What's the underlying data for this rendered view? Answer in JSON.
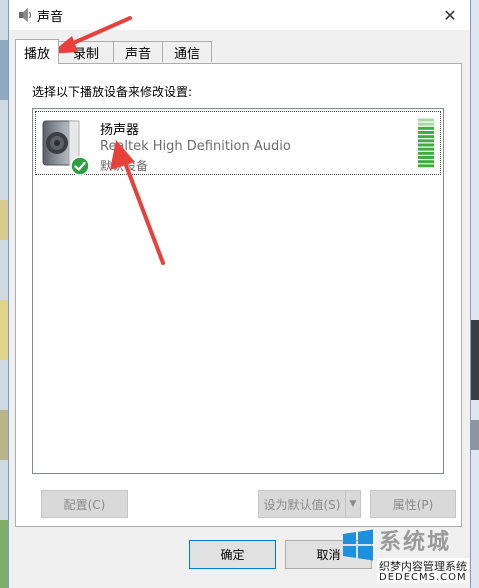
{
  "window": {
    "title": "声音",
    "close_glyph": "✕"
  },
  "tabs": [
    {
      "label": "播放",
      "active": true
    },
    {
      "label": "录制",
      "active": false
    },
    {
      "label": "声音",
      "active": false
    },
    {
      "label": "通信",
      "active": false
    }
  ],
  "playback": {
    "instruction": "选择以下播放设备来修改设置:",
    "devices": [
      {
        "name": "扬声器",
        "description": "Realtek High Definition Audio",
        "status": "默认设备",
        "icon": "speaker-icon",
        "badge_icon": "check-badge-icon",
        "level_segments_total": 12,
        "level_segments_lit": 10
      }
    ],
    "buttons": {
      "configure": "配置(C)",
      "set_default": "设为默认值(S)",
      "set_default_arrow": "▼",
      "properties": "属性(P)"
    }
  },
  "footer": {
    "ok": "确定",
    "cancel": "取消"
  },
  "watermark": {
    "brand": "系统城",
    "subtitle": "织梦内容管理系统",
    "url": "DEDECMS.COM"
  },
  "colors": {
    "accent": "#0078d7",
    "level_green": "#3fae3f",
    "level_green_dim": "#a6d8a6",
    "annotation_arrow": "#e8403a",
    "check_green": "#2ea043"
  }
}
